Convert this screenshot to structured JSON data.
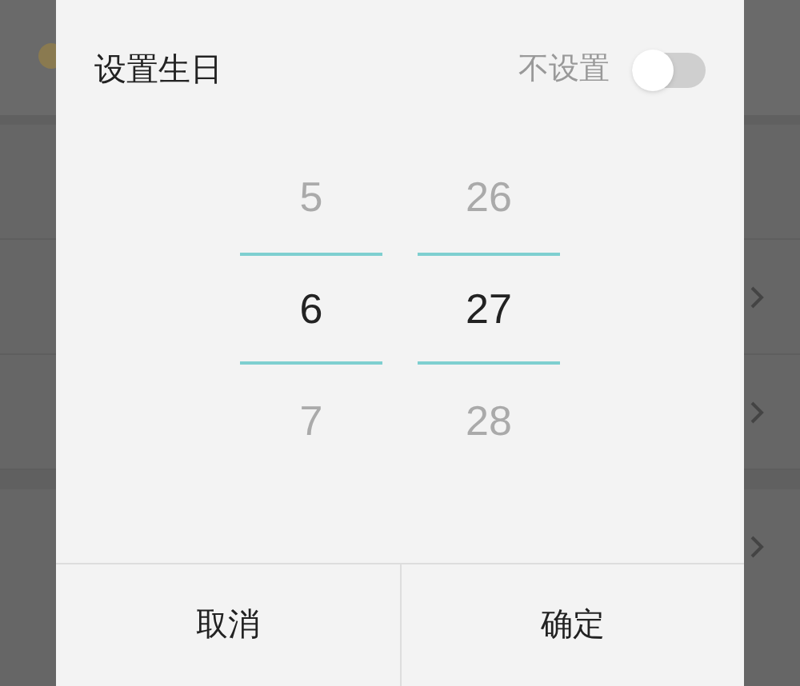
{
  "dialog": {
    "title": "设置生日",
    "toggle": {
      "label": "不设置",
      "on": false
    },
    "columns": [
      {
        "values": [
          {
            "text": "5",
            "selected": false
          },
          {
            "text": "6",
            "selected": true
          },
          {
            "text": "7",
            "selected": false
          }
        ]
      },
      {
        "values": [
          {
            "text": "26",
            "selected": false
          },
          {
            "text": "27",
            "selected": true
          },
          {
            "text": "28",
            "selected": false
          }
        ]
      }
    ],
    "buttons": [
      "取消",
      "确定"
    ]
  }
}
